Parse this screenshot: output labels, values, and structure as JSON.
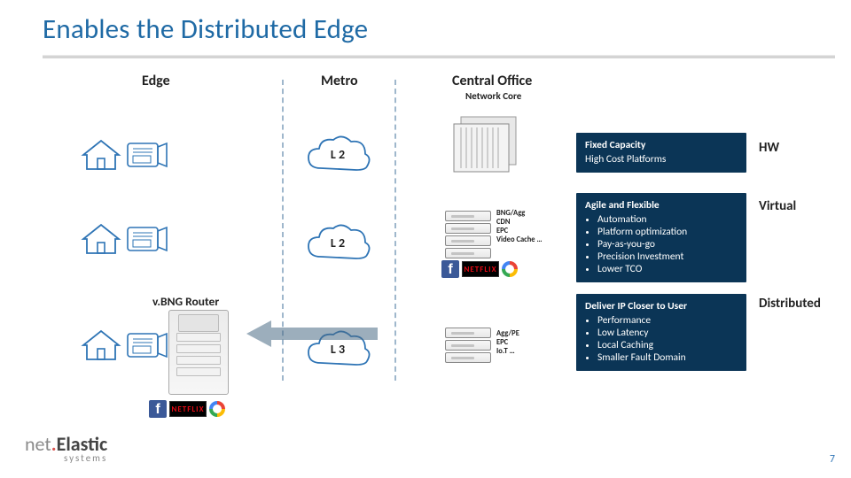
{
  "title": "Enables the Distributed Edge",
  "columns": {
    "edge": "Edge",
    "metro": "Metro",
    "central": "Central Office",
    "central_sub": "Network Core"
  },
  "clouds": {
    "r1": "L 2",
    "r2": "L 2",
    "r3": "L 3"
  },
  "vbng_label": "v.BNG Router",
  "server_labels_r2": [
    "BNG/Agg",
    "CDN",
    "EPC",
    "Video Cache …"
  ],
  "server_labels_r3": [
    "Agg/PE",
    "EPC",
    "Io.T …"
  ],
  "app_icons": [
    "facebook",
    "netflix",
    "google"
  ],
  "callouts": {
    "r1": {
      "head": "Fixed Capacity",
      "sub": "High Cost Platforms",
      "bullets": []
    },
    "r2": {
      "head": "Agile and Flexible",
      "bullets": [
        "Automation",
        "Platform optimization",
        "Pay-as-you-go",
        "Precision Investment",
        "Lower TCO"
      ]
    },
    "r3": {
      "head": "Deliver IP Closer to User",
      "bullets": [
        "Performance",
        "Low Latency",
        "Local Caching",
        "Smaller Fault Domain"
      ]
    }
  },
  "tags": {
    "r1": "HW",
    "r2": "Virtual",
    "r3": "Distributed"
  },
  "footer": {
    "brand_a": "net",
    "brand_dot": ".",
    "brand_b": "Elastic",
    "brand_sub": "systems",
    "page": "7"
  }
}
